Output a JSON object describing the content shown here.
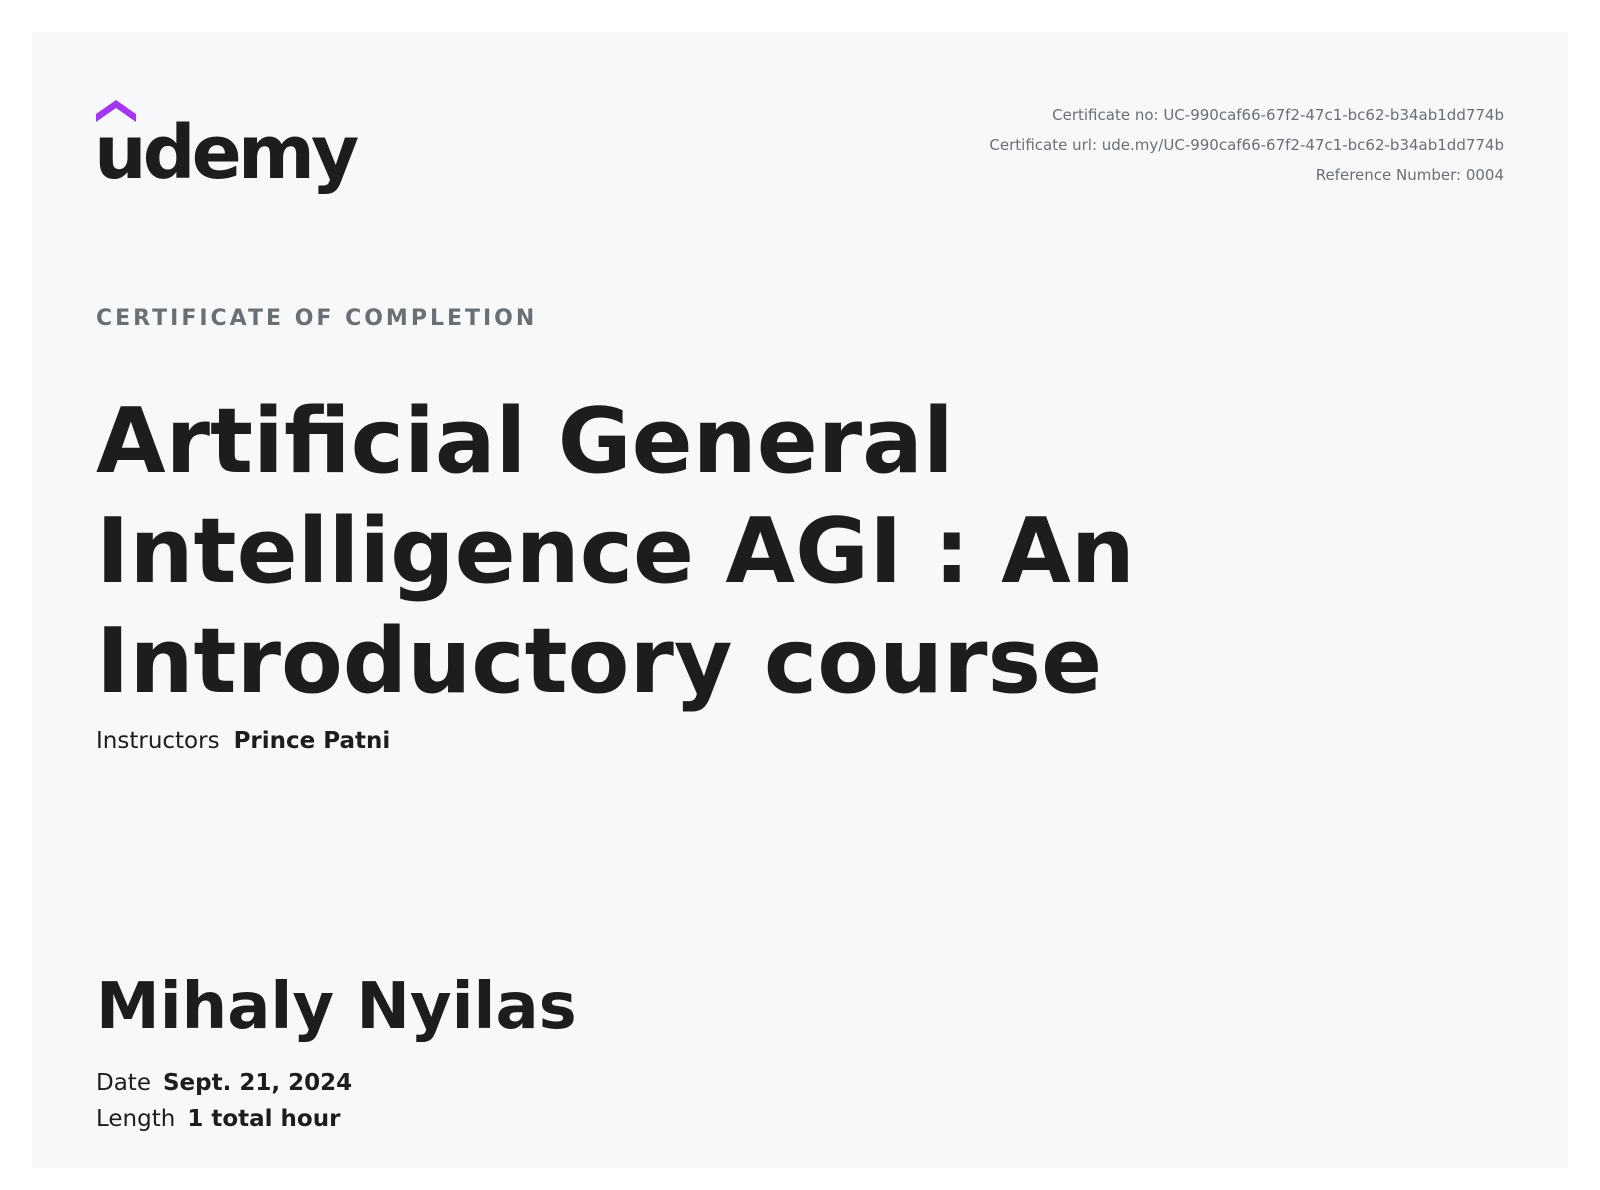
{
  "brand": {
    "name": "udemy",
    "accent_color": "#a435f0",
    "text_color": "#1c1d1f"
  },
  "meta": {
    "certificate_no": "Certificate no: UC-990caf66-67f2-47c1-bc62-b34ab1dd774b",
    "certificate_url": "Certificate url: ude.my/UC-990caf66-67f2-47c1-bc62-b34ab1dd774b",
    "reference_number": "Reference Number: 0004"
  },
  "certificate": {
    "kicker": "CERTIFICATE OF COMPLETION",
    "course_title": "Artificial General Intelligence AGI : An Introductory course",
    "instructors_label": "Instructors",
    "instructors_value": "Prince Patni",
    "recipient": "Mihaly Nyilas",
    "date_label": "Date",
    "date_value": "Sept. 21, 2024",
    "length_label": "Length",
    "length_value": "1 total hour"
  }
}
